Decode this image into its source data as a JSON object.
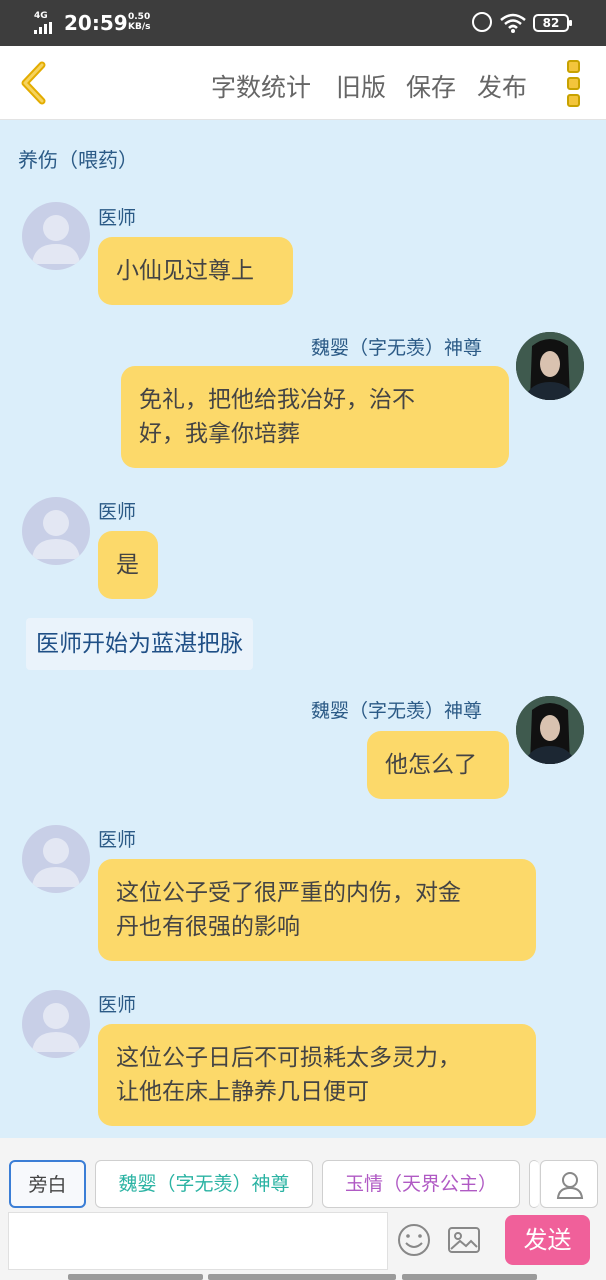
{
  "status_bar": {
    "network": "4G",
    "time": "20:59",
    "speed_value": "0.50",
    "speed_unit": "KB/s",
    "battery": "82"
  },
  "toolbar": {
    "back_icon": "chevron-left-icon",
    "word_count": "字数统计",
    "old_version": "旧版",
    "save": "保存",
    "publish": "发布",
    "menu_icon": "vertical-dots-icon"
  },
  "section_title": "养伤（喂药）",
  "messages": [
    {
      "speaker": "医师",
      "text": "小仙见过尊上"
    },
    {
      "speaker": "魏婴（字无羡）神尊",
      "line1": "免礼，把他给我冶好，治不",
      "line2": "好，我拿你培葬"
    },
    {
      "speaker": "医师",
      "text": "是"
    },
    {
      "narration": "医师开始为蓝湛把脉"
    },
    {
      "speaker": "魏婴（字无羡）神尊",
      "text": "他怎么了"
    },
    {
      "speaker": "医师",
      "line1": "这位公子受了很严重的内伤，对金",
      "line2": "丹也有很强的影响"
    },
    {
      "speaker": "医师",
      "line1": "这位公子日后不可损耗太多灵力，",
      "line2": "让他在床上静养几日便可"
    }
  ],
  "characters": [
    "旁白",
    "魏婴（字无羡）神尊",
    "玉情（天界公主）"
  ],
  "input": {
    "placeholder": ""
  },
  "send_label": "发送",
  "colors": {
    "background": "#dbeefa",
    "bubble": "#fcd96a",
    "send": "#f0609a",
    "name": "#2b5a86"
  }
}
